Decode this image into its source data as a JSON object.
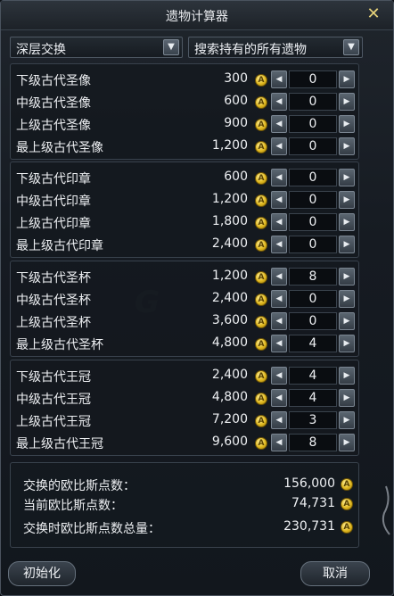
{
  "window": {
    "title": "遗物计算器",
    "close_glyph": "✕"
  },
  "filters": {
    "left": "深层交换",
    "right": "搜索持有的所有遗物",
    "arrow_glyph": "▼"
  },
  "coin_glyph": "A",
  "stepper": {
    "left_glyph": "◀",
    "right_glyph": "▶"
  },
  "groups": [
    {
      "rows": [
        {
          "name": "下级古代圣像",
          "price": "300",
          "qty": "0"
        },
        {
          "name": "中级古代圣像",
          "price": "600",
          "qty": "0"
        },
        {
          "name": "上级古代圣像",
          "price": "900",
          "qty": "0"
        },
        {
          "name": "最上级古代圣像",
          "price": "1,200",
          "qty": "0"
        }
      ]
    },
    {
      "rows": [
        {
          "name": "下级古代印章",
          "price": "600",
          "qty": "0"
        },
        {
          "name": "中级古代印章",
          "price": "1,200",
          "qty": "0"
        },
        {
          "name": "上级古代印章",
          "price": "1,800",
          "qty": "0"
        },
        {
          "name": "最上级古代印章",
          "price": "2,400",
          "qty": "0"
        }
      ]
    },
    {
      "rows": [
        {
          "name": "下级古代圣杯",
          "price": "1,200",
          "qty": "8"
        },
        {
          "name": "中级古代圣杯",
          "price": "2,400",
          "qty": "0"
        },
        {
          "name": "上级古代圣杯",
          "price": "3,600",
          "qty": "0"
        },
        {
          "name": "最上级古代圣杯",
          "price": "4,800",
          "qty": "4"
        }
      ]
    },
    {
      "rows": [
        {
          "name": "下级古代王冠",
          "price": "2,400",
          "qty": "4"
        },
        {
          "name": "中级古代王冠",
          "price": "4,800",
          "qty": "4"
        },
        {
          "name": "上级古代王冠",
          "price": "7,200",
          "qty": "3"
        },
        {
          "name": "最上级古代王冠",
          "price": "9,600",
          "qty": "8"
        }
      ]
    }
  ],
  "summary": {
    "exchange_label": "交换的欧比斯点数：",
    "exchange_value": "156,000",
    "current_label": "当前欧比斯点数：",
    "current_value": "74,731",
    "total_label": "交换时欧比斯点数总量：",
    "total_value": "230,731"
  },
  "buttons": {
    "reset": "初始化",
    "cancel": "取消"
  }
}
